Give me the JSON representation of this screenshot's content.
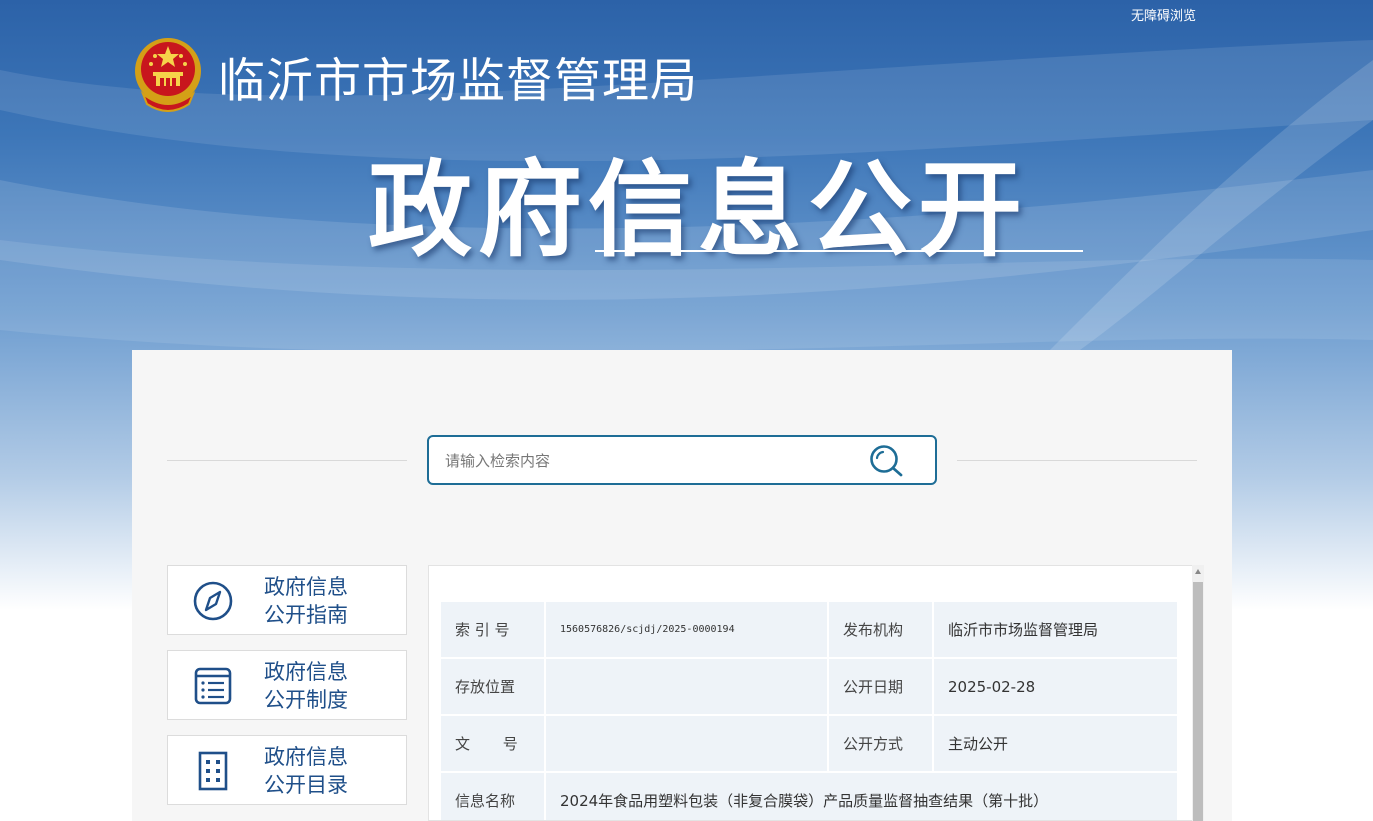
{
  "header": {
    "accessibility_link": "无障碍浏览",
    "site_title": "临沂市市场监督管理局",
    "page_title": "政府信息公开"
  },
  "search": {
    "placeholder": "请输入检索内容"
  },
  "sidebar": {
    "items": [
      {
        "line1": "政府信息",
        "line2": "公开指南",
        "icon": "compass-icon"
      },
      {
        "line1": "政府信息",
        "line2": "公开制度",
        "icon": "document-list-icon"
      },
      {
        "line1": "政府信息",
        "line2": "公开目录",
        "icon": "building-icon"
      }
    ]
  },
  "info_table": {
    "index_label": "索 引 号",
    "index_value": "1560576826/scjdj/2025-0000194",
    "publisher_label": "发布机构",
    "publisher_value": "临沂市市场监督管理局",
    "location_label": "存放位置",
    "location_value": "",
    "date_label": "公开日期",
    "date_value": "2025-02-28",
    "doc_no_label": "文 号",
    "doc_no_value": "",
    "method_label": "公开方式",
    "method_value": "主动公开",
    "name_label": "信息名称",
    "name_value": "2024年食品用塑料包装（非复合膜袋）产品质量监督抽查结果（第十批）"
  },
  "colors": {
    "banner_top": "#2c62a8",
    "accent": "#1e6d96",
    "sidebar_text": "#1f4f89",
    "table_cell": "#eef3f8"
  }
}
